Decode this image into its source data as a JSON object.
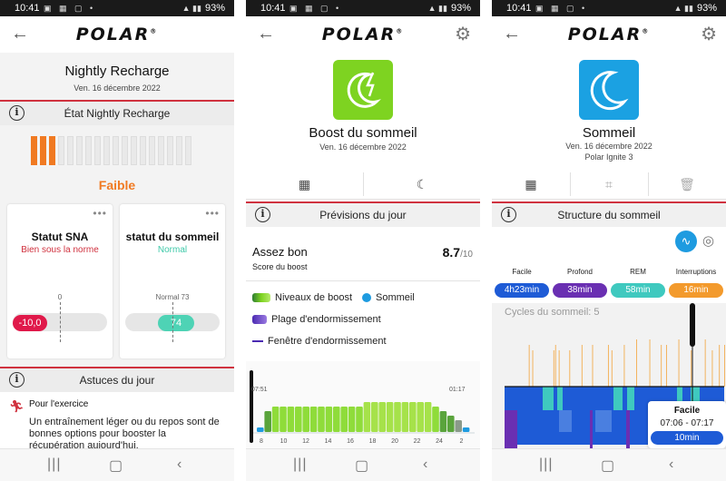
{
  "status": {
    "time": "10:41",
    "battery": "93%"
  },
  "brand": "POLAR",
  "panel1": {
    "title": "Nightly Recharge",
    "date": "Ven. 16 décembre 2022",
    "section_state": "État Nightly Recharge",
    "bars_filled": 3,
    "bars_total": 18,
    "level": "Faible",
    "card_sna": {
      "title": "Statut SNA",
      "status": "Bien sous la norme",
      "ref": "0",
      "value": "-10,0"
    },
    "card_sleep": {
      "title": "statut du sommeil",
      "status": "Normal",
      "ref": "Normal 73",
      "value": "74"
    },
    "section_tips": "Astuces du jour",
    "tip_title": "Pour l'exercice",
    "tip_body": "Un entraînement léger ou du repos sont de bonnes options pour booster la récupération aujourd'hui."
  },
  "panel2": {
    "title": "Boost du sommeil",
    "date": "Ven. 16 décembre 2022",
    "section": "Prévisions du jour",
    "score_label": "Assez bon",
    "score_sub": "Score du boost",
    "score_value": "8.7",
    "score_max": "/10",
    "legend_boost": "Niveaux de boost",
    "legend_sleep": "Sommeil",
    "legend_range": "Plage d'endormissement",
    "legend_window": "Fenêtre d'endormissement",
    "time_left": "07:51",
    "time_right": "01:17",
    "ticks": [
      "8",
      "10",
      "12",
      "14",
      "16",
      "18",
      "20",
      "22",
      "24",
      "2"
    ],
    "boost_levels": [
      0,
      3,
      4,
      4,
      4,
      4,
      4,
      4,
      4,
      4,
      4,
      4,
      4,
      4,
      5,
      5,
      5,
      5,
      5,
      5,
      5,
      5,
      5,
      4,
      3,
      2,
      1,
      0
    ]
  },
  "panel3": {
    "title": "Sommeil",
    "date": "Ven. 16 décembre 2022",
    "device": "Polar Ignite 3",
    "section": "Structure du sommeil",
    "categories": [
      {
        "label": "Facile",
        "value": "4h23min",
        "color": "#1e5bd6"
      },
      {
        "label": "Profond",
        "value": "38min",
        "color": "#6a2fb2"
      },
      {
        "label": "REM",
        "value": "58min",
        "color": "#3fc9bf"
      },
      {
        "label": "Interruptions",
        "value": "16min",
        "color": "#f39a2c"
      }
    ],
    "cycles": "Cycles du sommeil: 5",
    "tooltip": {
      "title": "Facile",
      "range": "07:06 - 07:17",
      "duration": "10min"
    }
  }
}
